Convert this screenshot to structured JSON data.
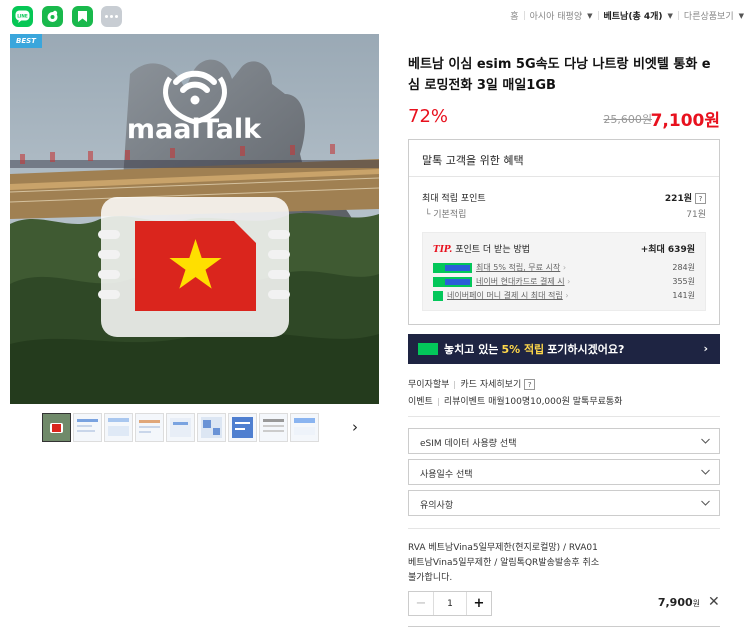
{
  "top_icons": [
    {
      "name": "line-share-icon",
      "color": "#06c755"
    },
    {
      "name": "band-share-icon",
      "color": "#19b94c"
    },
    {
      "name": "bookmark-icon",
      "color": "#19b94c"
    },
    {
      "name": "more-icon",
      "color": "#c8cdd3"
    }
  ],
  "breadcrumb": {
    "home": "홈",
    "region": "아시아 태평양",
    "country": "베트남(총 4개)",
    "other": "다른상품보기"
  },
  "product": {
    "badge": "BEST",
    "brand": "maalTalk",
    "title": "베트남 이심 esim 5G속도 다낭 나트랑 비엣텔 통화 e심 로밍전화 3일 매일1GB",
    "discount": "72%",
    "original_price": "25,600원",
    "final_price": "7,100원"
  },
  "benefits": {
    "title": "말톡 고객을 위한 혜택",
    "max_points_label": "최대 적립 포인트",
    "max_points_value": "221원",
    "basic_label": "기본적립",
    "basic_value": "71원",
    "tip_label": "TIP.",
    "tip_text": "포인트 더 받는 방법",
    "tip_max": "+최대 639원",
    "tips": [
      {
        "text": "최대 5% 적립, 무료 시작",
        "value": "284원"
      },
      {
        "text": "네이버 현대카드로 결제 시",
        "value": "355원"
      },
      {
        "text": "네이버페이 머니 결제 시 최대 적립",
        "value": "141원"
      }
    ]
  },
  "banner": {
    "pre": "놓치고 있는",
    "highlight": "5% 적립",
    "post": "포기하시겠어요?"
  },
  "info": {
    "installment": "무이자할부",
    "card_detail": "카드 자세히보기",
    "event_label": "이벤트",
    "event_text": "리뷰이벤트 매월100명10,000원 말톡무료통화"
  },
  "selects": [
    {
      "label": "eSIM 데이터 사용량 선택"
    },
    {
      "label": "사용일수 선택"
    },
    {
      "label": "유의사항"
    }
  ],
  "option": {
    "line1": "RVA 베트남Vina5일무제한(현지로컬망) / RVA01",
    "line2": "베트남Vina5일무제한 / 알림톡QR발송발송후 취소",
    "line3": "불가합니다.",
    "quantity": "1",
    "price": "7,900",
    "won": "원"
  },
  "colors": {
    "accent_red": "#e8111e",
    "naver_green": "#03c75a",
    "banner_bg": "#1e2442",
    "banner_highlight": "#ffd84a"
  }
}
